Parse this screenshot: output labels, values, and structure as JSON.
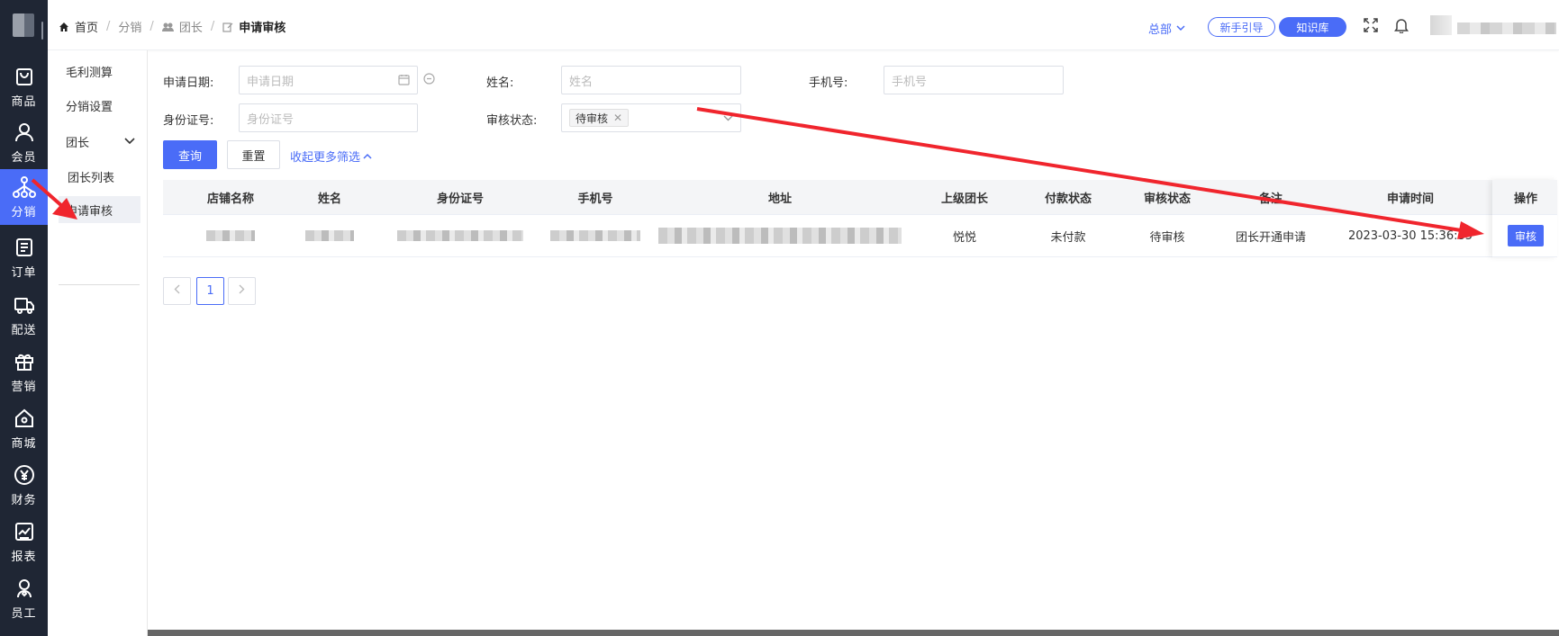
{
  "sidebar": {
    "items": [
      {
        "label": "商品",
        "icon": "bag-icon"
      },
      {
        "label": "会员",
        "icon": "user-icon"
      },
      {
        "label": "分销",
        "icon": "hierarchy-icon"
      },
      {
        "label": "订单",
        "icon": "document-icon"
      },
      {
        "label": "配送",
        "icon": "truck-icon"
      },
      {
        "label": "营销",
        "icon": "gift-icon"
      },
      {
        "label": "商城",
        "icon": "shop-icon"
      },
      {
        "label": "财务",
        "icon": "yen-icon"
      },
      {
        "label": "报表",
        "icon": "chart-icon"
      },
      {
        "label": "员工",
        "icon": "staff-icon"
      }
    ],
    "active_index": 2
  },
  "subnav": {
    "items": [
      {
        "label": "毛利测算"
      },
      {
        "label": "分销设置"
      },
      {
        "label": "团长"
      },
      {
        "label": "团长列表"
      },
      {
        "label": "申请审核"
      }
    ],
    "active_index": 4
  },
  "header": {
    "breadcrumb": {
      "home": "首页",
      "level1": "分销",
      "level2": "团长",
      "current": "申请审核"
    },
    "branch": "总部",
    "guide_button": "新手引导",
    "kb_button": "知识库"
  },
  "filters": {
    "date_label": "申请日期:",
    "date_placeholder": "申请日期",
    "name_label": "姓名:",
    "name_placeholder": "姓名",
    "phone_label": "手机号:",
    "phone_placeholder": "手机号",
    "id_label": "身份证号:",
    "id_placeholder": "身份证号",
    "status_label": "审核状态:",
    "status_tag": "待审核",
    "query_button": "查询",
    "reset_button": "重置",
    "collapse_link": "收起更多筛选"
  },
  "table": {
    "columns": [
      "店铺名称",
      "姓名",
      "身份证号",
      "手机号",
      "地址",
      "上级团长",
      "付款状态",
      "审核状态",
      "备注",
      "申请时间",
      "操作"
    ],
    "rows": [
      {
        "superior": "悦悦",
        "pay_status": "未付款",
        "review_status": "待审核",
        "remark": "团长开通申请",
        "apply_time": "2023-03-30 15:36:35",
        "action": "审核"
      }
    ]
  },
  "pagination": {
    "current_page": "1"
  },
  "colors": {
    "sidebar_bg": "#1f2634",
    "accent": "#4a6cf7",
    "annotation_arrow": "#f0252d"
  }
}
